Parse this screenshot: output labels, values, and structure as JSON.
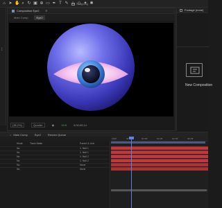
{
  "app": {
    "snapping_label": "Snapping"
  },
  "composition_panel": {
    "title": "Composition Eye2",
    "tabs": [
      "Main Comp",
      "Eye2"
    ],
    "active_tab": 1,
    "footer": {
      "zoom": "(36.2%)",
      "resolution": "Quarter",
      "exposure": "+0.0",
      "timecode": "0;00;00;14"
    }
  },
  "project_panel": {
    "title": "Footage (none)",
    "new_composition_label": "New Composition"
  },
  "timeline": {
    "tabs": [
      "Main Comp",
      "Eye2",
      "Render Queue"
    ],
    "columns": {
      "mode": "Mode",
      "trkmat": "Track Matte",
      "parent": "Parent & Link"
    },
    "layers": [
      {
        "mode": "No",
        "parent": "1. Null 1"
      },
      {
        "mode": "No",
        "parent": "1. Null 1"
      },
      {
        "mode": "No",
        "parent": "1. Null 2"
      },
      {
        "mode": "No",
        "parent": "1. Null 2"
      },
      {
        "mode": "No",
        "parent": "None"
      },
      {
        "mode": "No",
        "parent": "None"
      }
    ],
    "ruler_labels": [
      "0:00f",
      "00:15f",
      "01:00f",
      "01:15f",
      "02:00f",
      "02:15f"
    ]
  },
  "colors": {
    "track_red": "#bb3b3f",
    "playhead_blue": "#5a84e0",
    "work_area": "#5c6fa6"
  }
}
